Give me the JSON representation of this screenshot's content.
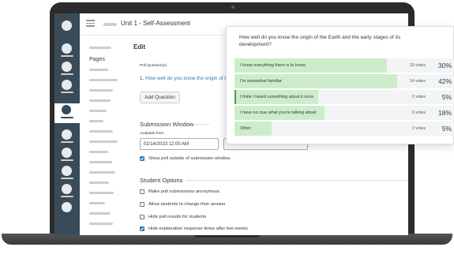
{
  "header": {
    "breadcrumb": "Unit 1 - Self-Assessment"
  },
  "sidebar": {
    "pages_label": "Pages"
  },
  "editor": {
    "title": "Edit",
    "poll_questions_label": "Poll Question(s)",
    "question_number": "1.",
    "question_link": "How well do you know the origin of t",
    "add_question_label": "Add Question"
  },
  "submission_window": {
    "title": "Submission Window",
    "available_from_label": "Available from",
    "available_from_value": "02/14/2023 12:00 AM",
    "show_outside_label": "Show poll outside of submission window",
    "show_outside_checked": true
  },
  "student_options": {
    "title": "Student Options",
    "options": [
      {
        "label": "Make poll submissions anonymous",
        "checked": false
      },
      {
        "label": "Allow students to change their answer",
        "checked": false
      },
      {
        "label": "Hide poll results for students",
        "checked": false
      },
      {
        "label": "Hide explanation response times after two weeks",
        "checked": true
      }
    ]
  },
  "poll_results": {
    "question": "How well do you know the origin of the Earth and the early stages of its development?",
    "answers": [
      {
        "label": "I know everything there is to know",
        "votes": "10 votes",
        "percent": "30%",
        "share": 0.69
      },
      {
        "label": "I'm somewhat familiar",
        "votes": "14 votes",
        "percent": "42%",
        "share": 0.74
      },
      {
        "label": "I think I heard something about it once",
        "votes": "2 votes",
        "percent": "5%",
        "share": 0.38
      },
      {
        "label": "I have no clue what you're talking about",
        "votes": "6 votes",
        "percent": "18%",
        "share": 0.41
      },
      {
        "label": "Other",
        "votes": "2 votes",
        "percent": "5%",
        "share": 0.17
      }
    ],
    "colors": {
      "fill": "#cdeccb",
      "accent": "#3aa547",
      "link": "#2b7abc",
      "nav": "#394b58"
    }
  }
}
